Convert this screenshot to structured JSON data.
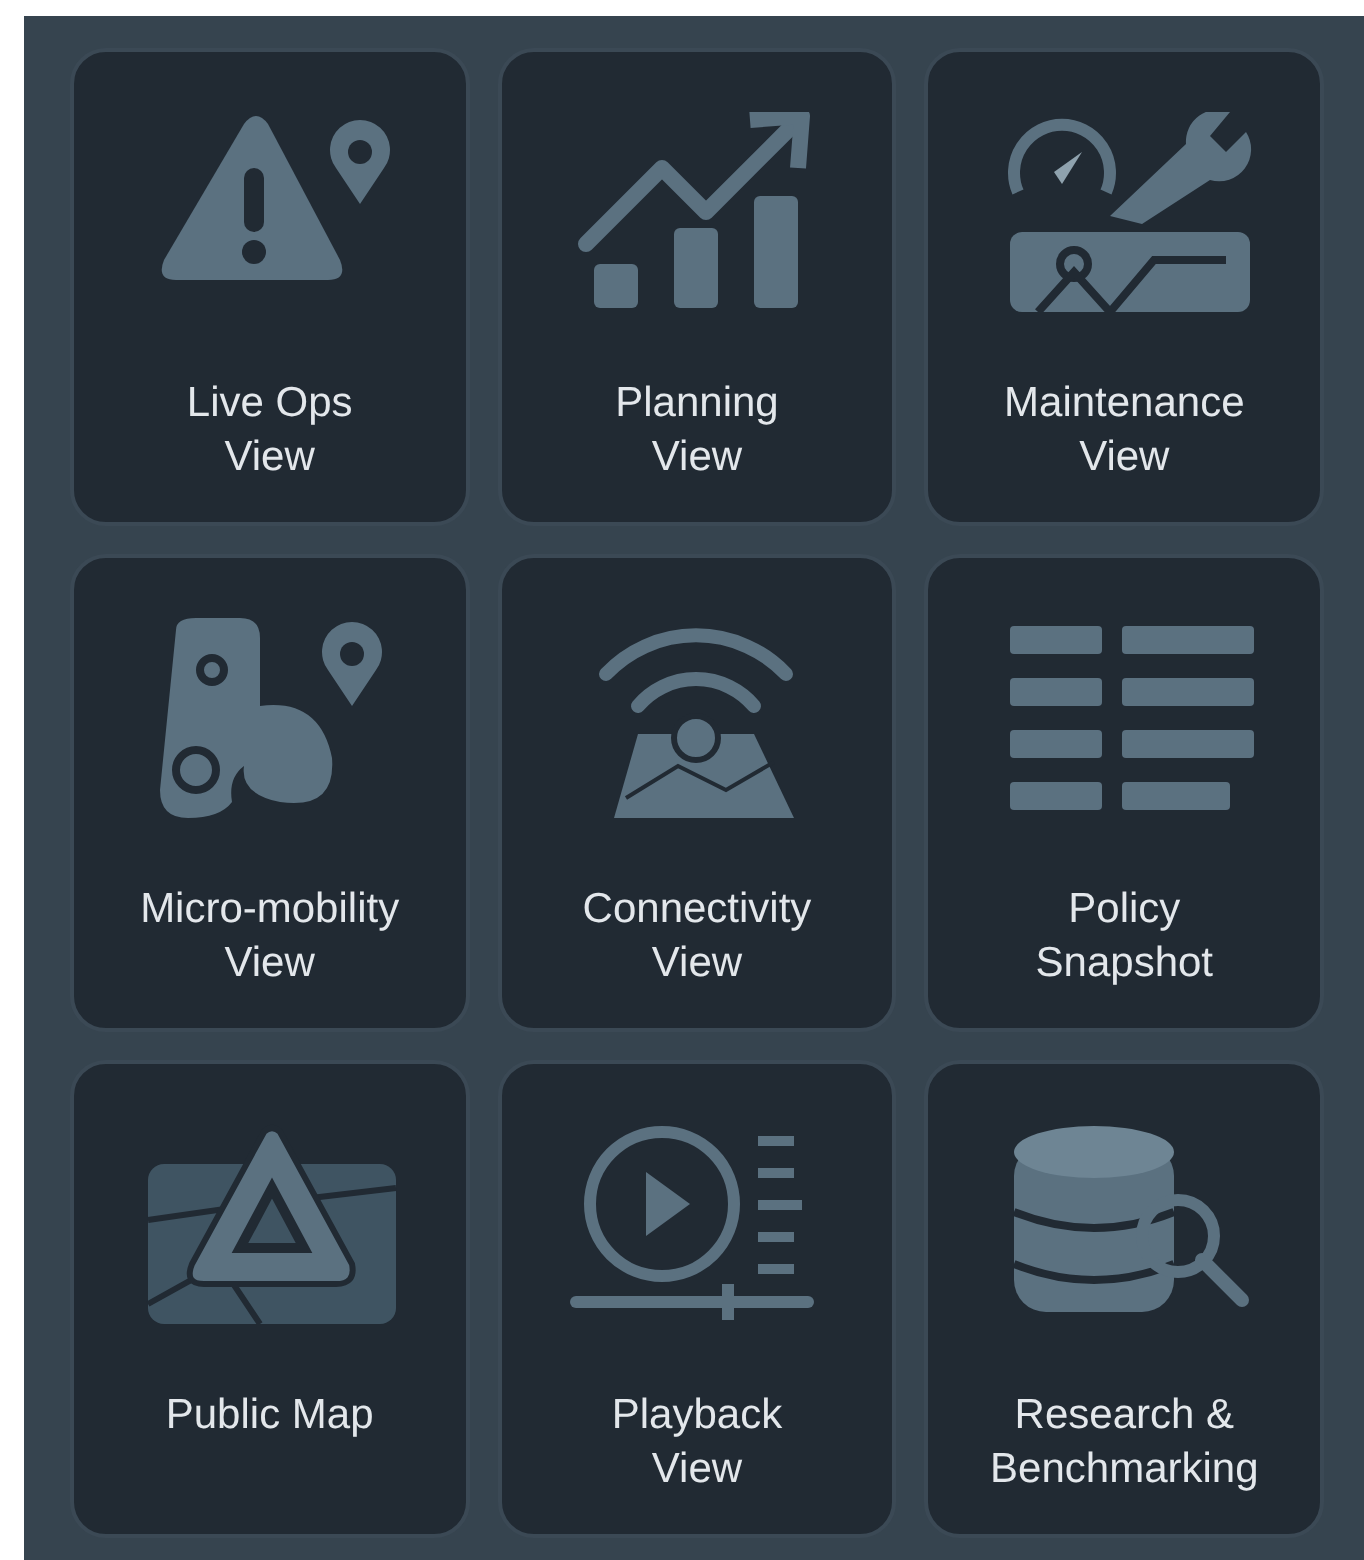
{
  "tiles": [
    {
      "label": "Live Ops\nView",
      "kind": "alert-pin"
    },
    {
      "label": "Planning\nView",
      "kind": "growth-chart"
    },
    {
      "label": "Maintenance\nView",
      "kind": "maintenance"
    },
    {
      "label": "Micro-mobility\nView",
      "kind": "micro-mobility"
    },
    {
      "label": "Connectivity\nView",
      "kind": "connectivity"
    },
    {
      "label": "Policy\nSnapshot",
      "kind": "policy-list"
    },
    {
      "label": "Public Map",
      "kind": "public-map"
    },
    {
      "label": "Playback\nView",
      "kind": "playback"
    },
    {
      "label": "Research &\nBenchmarking",
      "kind": "research"
    }
  ]
}
